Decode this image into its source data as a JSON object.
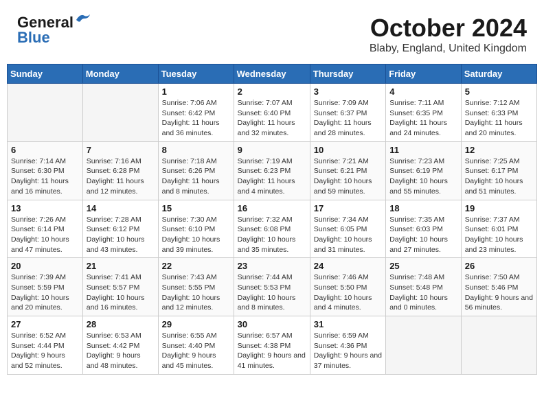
{
  "header": {
    "logo_line1": "General",
    "logo_line2": "Blue",
    "month_title": "October 2024",
    "location": "Blaby, England, United Kingdom"
  },
  "weekdays": [
    "Sunday",
    "Monday",
    "Tuesday",
    "Wednesday",
    "Thursday",
    "Friday",
    "Saturday"
  ],
  "weeks": [
    [
      {
        "day": "",
        "sunrise": "",
        "sunset": "",
        "daylight": ""
      },
      {
        "day": "",
        "sunrise": "",
        "sunset": "",
        "daylight": ""
      },
      {
        "day": "1",
        "sunrise": "Sunrise: 7:06 AM",
        "sunset": "Sunset: 6:42 PM",
        "daylight": "Daylight: 11 hours and 36 minutes."
      },
      {
        "day": "2",
        "sunrise": "Sunrise: 7:07 AM",
        "sunset": "Sunset: 6:40 PM",
        "daylight": "Daylight: 11 hours and 32 minutes."
      },
      {
        "day": "3",
        "sunrise": "Sunrise: 7:09 AM",
        "sunset": "Sunset: 6:37 PM",
        "daylight": "Daylight: 11 hours and 28 minutes."
      },
      {
        "day": "4",
        "sunrise": "Sunrise: 7:11 AM",
        "sunset": "Sunset: 6:35 PM",
        "daylight": "Daylight: 11 hours and 24 minutes."
      },
      {
        "day": "5",
        "sunrise": "Sunrise: 7:12 AM",
        "sunset": "Sunset: 6:33 PM",
        "daylight": "Daylight: 11 hours and 20 minutes."
      }
    ],
    [
      {
        "day": "6",
        "sunrise": "Sunrise: 7:14 AM",
        "sunset": "Sunset: 6:30 PM",
        "daylight": "Daylight: 11 hours and 16 minutes."
      },
      {
        "day": "7",
        "sunrise": "Sunrise: 7:16 AM",
        "sunset": "Sunset: 6:28 PM",
        "daylight": "Daylight: 11 hours and 12 minutes."
      },
      {
        "day": "8",
        "sunrise": "Sunrise: 7:18 AM",
        "sunset": "Sunset: 6:26 PM",
        "daylight": "Daylight: 11 hours and 8 minutes."
      },
      {
        "day": "9",
        "sunrise": "Sunrise: 7:19 AM",
        "sunset": "Sunset: 6:23 PM",
        "daylight": "Daylight: 11 hours and 4 minutes."
      },
      {
        "day": "10",
        "sunrise": "Sunrise: 7:21 AM",
        "sunset": "Sunset: 6:21 PM",
        "daylight": "Daylight: 10 hours and 59 minutes."
      },
      {
        "day": "11",
        "sunrise": "Sunrise: 7:23 AM",
        "sunset": "Sunset: 6:19 PM",
        "daylight": "Daylight: 10 hours and 55 minutes."
      },
      {
        "day": "12",
        "sunrise": "Sunrise: 7:25 AM",
        "sunset": "Sunset: 6:17 PM",
        "daylight": "Daylight: 10 hours and 51 minutes."
      }
    ],
    [
      {
        "day": "13",
        "sunrise": "Sunrise: 7:26 AM",
        "sunset": "Sunset: 6:14 PM",
        "daylight": "Daylight: 10 hours and 47 minutes."
      },
      {
        "day": "14",
        "sunrise": "Sunrise: 7:28 AM",
        "sunset": "Sunset: 6:12 PM",
        "daylight": "Daylight: 10 hours and 43 minutes."
      },
      {
        "day": "15",
        "sunrise": "Sunrise: 7:30 AM",
        "sunset": "Sunset: 6:10 PM",
        "daylight": "Daylight: 10 hours and 39 minutes."
      },
      {
        "day": "16",
        "sunrise": "Sunrise: 7:32 AM",
        "sunset": "Sunset: 6:08 PM",
        "daylight": "Daylight: 10 hours and 35 minutes."
      },
      {
        "day": "17",
        "sunrise": "Sunrise: 7:34 AM",
        "sunset": "Sunset: 6:05 PM",
        "daylight": "Daylight: 10 hours and 31 minutes."
      },
      {
        "day": "18",
        "sunrise": "Sunrise: 7:35 AM",
        "sunset": "Sunset: 6:03 PM",
        "daylight": "Daylight: 10 hours and 27 minutes."
      },
      {
        "day": "19",
        "sunrise": "Sunrise: 7:37 AM",
        "sunset": "Sunset: 6:01 PM",
        "daylight": "Daylight: 10 hours and 23 minutes."
      }
    ],
    [
      {
        "day": "20",
        "sunrise": "Sunrise: 7:39 AM",
        "sunset": "Sunset: 5:59 PM",
        "daylight": "Daylight: 10 hours and 20 minutes."
      },
      {
        "day": "21",
        "sunrise": "Sunrise: 7:41 AM",
        "sunset": "Sunset: 5:57 PM",
        "daylight": "Daylight: 10 hours and 16 minutes."
      },
      {
        "day": "22",
        "sunrise": "Sunrise: 7:43 AM",
        "sunset": "Sunset: 5:55 PM",
        "daylight": "Daylight: 10 hours and 12 minutes."
      },
      {
        "day": "23",
        "sunrise": "Sunrise: 7:44 AM",
        "sunset": "Sunset: 5:53 PM",
        "daylight": "Daylight: 10 hours and 8 minutes."
      },
      {
        "day": "24",
        "sunrise": "Sunrise: 7:46 AM",
        "sunset": "Sunset: 5:50 PM",
        "daylight": "Daylight: 10 hours and 4 minutes."
      },
      {
        "day": "25",
        "sunrise": "Sunrise: 7:48 AM",
        "sunset": "Sunset: 5:48 PM",
        "daylight": "Daylight: 10 hours and 0 minutes."
      },
      {
        "day": "26",
        "sunrise": "Sunrise: 7:50 AM",
        "sunset": "Sunset: 5:46 PM",
        "daylight": "Daylight: 9 hours and 56 minutes."
      }
    ],
    [
      {
        "day": "27",
        "sunrise": "Sunrise: 6:52 AM",
        "sunset": "Sunset: 4:44 PM",
        "daylight": "Daylight: 9 hours and 52 minutes."
      },
      {
        "day": "28",
        "sunrise": "Sunrise: 6:53 AM",
        "sunset": "Sunset: 4:42 PM",
        "daylight": "Daylight: 9 hours and 48 minutes."
      },
      {
        "day": "29",
        "sunrise": "Sunrise: 6:55 AM",
        "sunset": "Sunset: 4:40 PM",
        "daylight": "Daylight: 9 hours and 45 minutes."
      },
      {
        "day": "30",
        "sunrise": "Sunrise: 6:57 AM",
        "sunset": "Sunset: 4:38 PM",
        "daylight": "Daylight: 9 hours and 41 minutes."
      },
      {
        "day": "31",
        "sunrise": "Sunrise: 6:59 AM",
        "sunset": "Sunset: 4:36 PM",
        "daylight": "Daylight: 9 hours and 37 minutes."
      },
      {
        "day": "",
        "sunrise": "",
        "sunset": "",
        "daylight": ""
      },
      {
        "day": "",
        "sunrise": "",
        "sunset": "",
        "daylight": ""
      }
    ]
  ]
}
